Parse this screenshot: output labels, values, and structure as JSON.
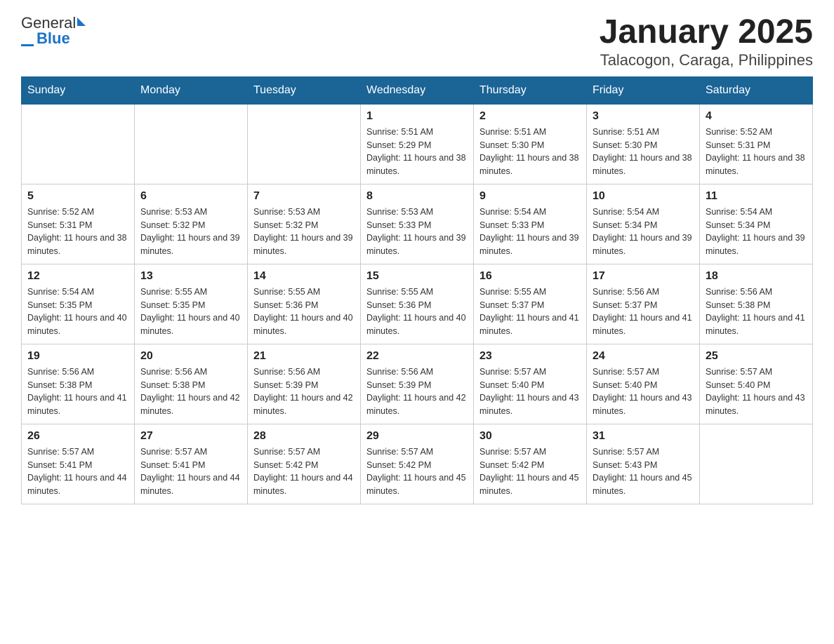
{
  "logo": {
    "general": "General",
    "blue": "Blue"
  },
  "title": "January 2025",
  "subtitle": "Talacogon, Caraga, Philippines",
  "days_of_week": [
    "Sunday",
    "Monday",
    "Tuesday",
    "Wednesday",
    "Thursday",
    "Friday",
    "Saturday"
  ],
  "weeks": [
    [
      {
        "day": "",
        "detail": ""
      },
      {
        "day": "",
        "detail": ""
      },
      {
        "day": "",
        "detail": ""
      },
      {
        "day": "1",
        "detail": "Sunrise: 5:51 AM\nSunset: 5:29 PM\nDaylight: 11 hours and 38 minutes."
      },
      {
        "day": "2",
        "detail": "Sunrise: 5:51 AM\nSunset: 5:30 PM\nDaylight: 11 hours and 38 minutes."
      },
      {
        "day": "3",
        "detail": "Sunrise: 5:51 AM\nSunset: 5:30 PM\nDaylight: 11 hours and 38 minutes."
      },
      {
        "day": "4",
        "detail": "Sunrise: 5:52 AM\nSunset: 5:31 PM\nDaylight: 11 hours and 38 minutes."
      }
    ],
    [
      {
        "day": "5",
        "detail": "Sunrise: 5:52 AM\nSunset: 5:31 PM\nDaylight: 11 hours and 38 minutes."
      },
      {
        "day": "6",
        "detail": "Sunrise: 5:53 AM\nSunset: 5:32 PM\nDaylight: 11 hours and 39 minutes."
      },
      {
        "day": "7",
        "detail": "Sunrise: 5:53 AM\nSunset: 5:32 PM\nDaylight: 11 hours and 39 minutes."
      },
      {
        "day": "8",
        "detail": "Sunrise: 5:53 AM\nSunset: 5:33 PM\nDaylight: 11 hours and 39 minutes."
      },
      {
        "day": "9",
        "detail": "Sunrise: 5:54 AM\nSunset: 5:33 PM\nDaylight: 11 hours and 39 minutes."
      },
      {
        "day": "10",
        "detail": "Sunrise: 5:54 AM\nSunset: 5:34 PM\nDaylight: 11 hours and 39 minutes."
      },
      {
        "day": "11",
        "detail": "Sunrise: 5:54 AM\nSunset: 5:34 PM\nDaylight: 11 hours and 39 minutes."
      }
    ],
    [
      {
        "day": "12",
        "detail": "Sunrise: 5:54 AM\nSunset: 5:35 PM\nDaylight: 11 hours and 40 minutes."
      },
      {
        "day": "13",
        "detail": "Sunrise: 5:55 AM\nSunset: 5:35 PM\nDaylight: 11 hours and 40 minutes."
      },
      {
        "day": "14",
        "detail": "Sunrise: 5:55 AM\nSunset: 5:36 PM\nDaylight: 11 hours and 40 minutes."
      },
      {
        "day": "15",
        "detail": "Sunrise: 5:55 AM\nSunset: 5:36 PM\nDaylight: 11 hours and 40 minutes."
      },
      {
        "day": "16",
        "detail": "Sunrise: 5:55 AM\nSunset: 5:37 PM\nDaylight: 11 hours and 41 minutes."
      },
      {
        "day": "17",
        "detail": "Sunrise: 5:56 AM\nSunset: 5:37 PM\nDaylight: 11 hours and 41 minutes."
      },
      {
        "day": "18",
        "detail": "Sunrise: 5:56 AM\nSunset: 5:38 PM\nDaylight: 11 hours and 41 minutes."
      }
    ],
    [
      {
        "day": "19",
        "detail": "Sunrise: 5:56 AM\nSunset: 5:38 PM\nDaylight: 11 hours and 41 minutes."
      },
      {
        "day": "20",
        "detail": "Sunrise: 5:56 AM\nSunset: 5:38 PM\nDaylight: 11 hours and 42 minutes."
      },
      {
        "day": "21",
        "detail": "Sunrise: 5:56 AM\nSunset: 5:39 PM\nDaylight: 11 hours and 42 minutes."
      },
      {
        "day": "22",
        "detail": "Sunrise: 5:56 AM\nSunset: 5:39 PM\nDaylight: 11 hours and 42 minutes."
      },
      {
        "day": "23",
        "detail": "Sunrise: 5:57 AM\nSunset: 5:40 PM\nDaylight: 11 hours and 43 minutes."
      },
      {
        "day": "24",
        "detail": "Sunrise: 5:57 AM\nSunset: 5:40 PM\nDaylight: 11 hours and 43 minutes."
      },
      {
        "day": "25",
        "detail": "Sunrise: 5:57 AM\nSunset: 5:40 PM\nDaylight: 11 hours and 43 minutes."
      }
    ],
    [
      {
        "day": "26",
        "detail": "Sunrise: 5:57 AM\nSunset: 5:41 PM\nDaylight: 11 hours and 44 minutes."
      },
      {
        "day": "27",
        "detail": "Sunrise: 5:57 AM\nSunset: 5:41 PM\nDaylight: 11 hours and 44 minutes."
      },
      {
        "day": "28",
        "detail": "Sunrise: 5:57 AM\nSunset: 5:42 PM\nDaylight: 11 hours and 44 minutes."
      },
      {
        "day": "29",
        "detail": "Sunrise: 5:57 AM\nSunset: 5:42 PM\nDaylight: 11 hours and 45 minutes."
      },
      {
        "day": "30",
        "detail": "Sunrise: 5:57 AM\nSunset: 5:42 PM\nDaylight: 11 hours and 45 minutes."
      },
      {
        "day": "31",
        "detail": "Sunrise: 5:57 AM\nSunset: 5:43 PM\nDaylight: 11 hours and 45 minutes."
      },
      {
        "day": "",
        "detail": ""
      }
    ]
  ]
}
